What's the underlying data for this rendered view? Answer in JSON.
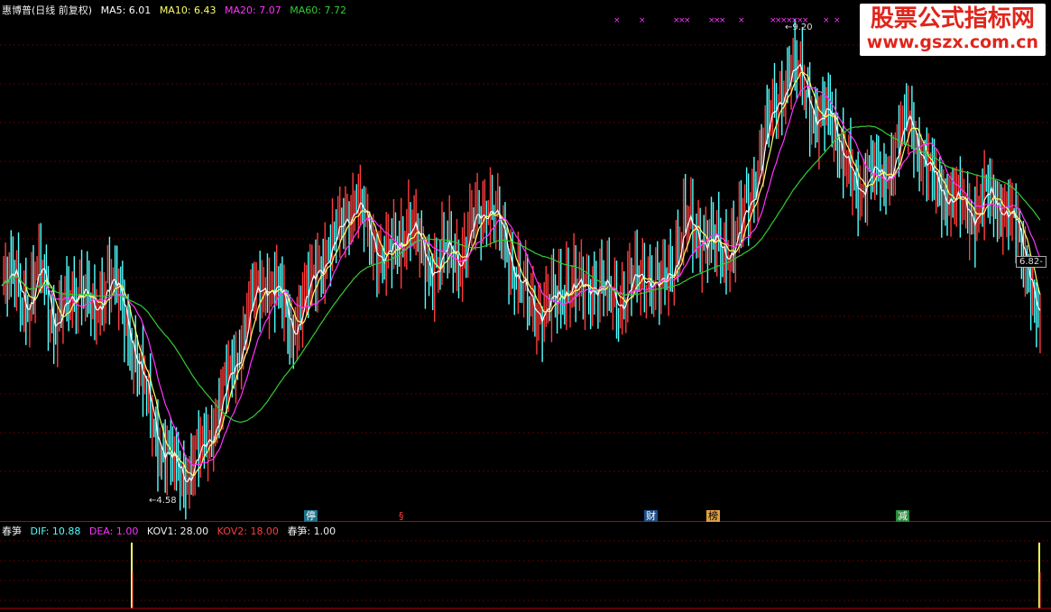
{
  "main_legend": {
    "title": "惠博普(日线 前复权)",
    "ma5": "MA5: 6.01",
    "ma10": "MA10: 6.43",
    "ma20": "MA20: 7.07",
    "ma60": "MA60: 7.72"
  },
  "indicator_legend": {
    "name": "春笋",
    "dif": "DIF: 10.88",
    "dea": "DEA: 1.00",
    "kov1": "KOV1: 28.00",
    "kov2": "KOV2: 18.00",
    "cs": "春笋: 1.00"
  },
  "price_labels": {
    "high": "9.20",
    "low": "4.58",
    "current": "6.82"
  },
  "markers": [
    "停",
    "§",
    "财",
    "榜",
    "减"
  ],
  "watermark": {
    "cn": "股票公式指标网",
    "url": "www.gszx.com.cn"
  },
  "colors": {
    "up": "#ff3c3c",
    "down": "#54ffff",
    "ma5": "#ffffff",
    "ma10": "#ffff66",
    "ma20": "#ff33ff",
    "ma60": "#33cc33"
  },
  "chart_data": {
    "type": "line",
    "y_range_main": [
      4.4,
      9.4
    ],
    "closes": [
      6.6,
      6.8,
      6.4,
      6.9,
      6.2,
      6.5,
      6.7,
      6.3,
      6.8,
      6.5,
      6.0,
      5.5,
      5.0,
      4.8,
      4.7,
      4.9,
      5.2,
      5.6,
      6.0,
      6.5,
      6.7,
      6.6,
      6.2,
      6.5,
      6.9,
      7.0,
      7.4,
      7.5,
      7.2,
      6.9,
      7.1,
      7.3,
      7.0,
      6.8,
      7.1,
      6.9,
      7.4,
      7.5,
      7.2,
      6.8,
      6.5,
      6.4,
      6.5,
      6.7,
      6.6,
      6.7,
      6.6,
      6.5,
      6.7,
      6.8,
      6.6,
      6.9,
      7.3,
      7.2,
      7.1,
      7.0,
      7.2,
      7.6,
      8.2,
      8.6,
      8.9,
      8.8,
      8.3,
      8.5,
      8.0,
      7.6,
      7.9,
      7.7,
      8.1,
      8.4,
      8.0,
      7.7,
      7.6,
      7.5,
      7.4,
      7.6,
      7.5,
      7.3,
      6.9,
      6.1
    ],
    "spikes": [
      12,
      79
    ]
  }
}
